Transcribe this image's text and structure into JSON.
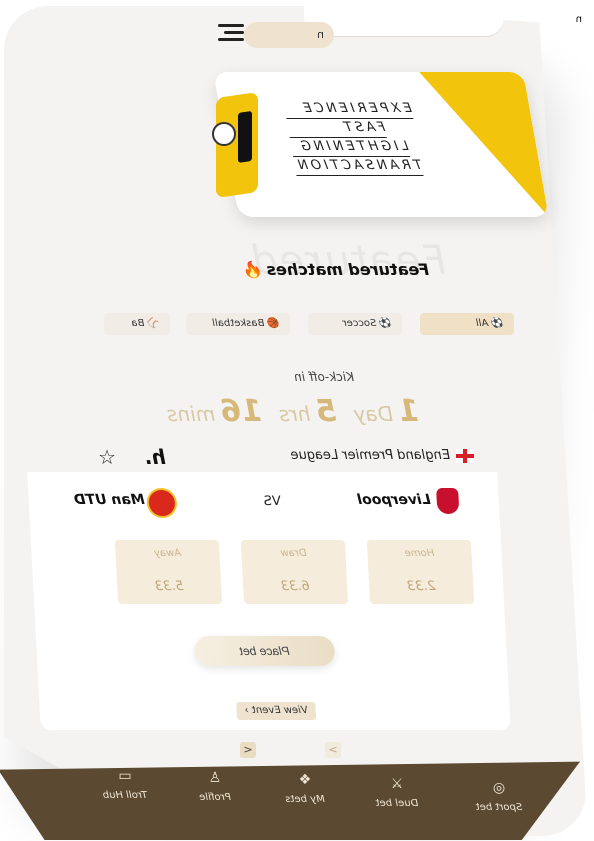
{
  "header": {
    "pill_text": "n",
    "corner_tag": "n"
  },
  "banner": {
    "lines": [
      "EXPERIENCE",
      "FAST",
      "LIGHTENING",
      "TRANSACTION"
    ]
  },
  "featured": {
    "ghost_text": "Featured",
    "title": "Featured matches",
    "emoji": "🔥"
  },
  "sports_tabs": [
    {
      "label": "All",
      "icon": "⚽",
      "active": true
    },
    {
      "label": "Soccer",
      "icon": "⚽",
      "active": false
    },
    {
      "label": "Basketball",
      "icon": "🏀",
      "active": false
    },
    {
      "label": "Ba",
      "icon": "⚾",
      "active": false
    }
  ],
  "kickoff": {
    "label": "Kick-off in",
    "days": "1",
    "days_unit": "Day",
    "hours": "5",
    "hours_unit": "hrs",
    "mins": "16",
    "mins_unit": "mins"
  },
  "league": {
    "name": "England Premier League",
    "brand": "h."
  },
  "match": {
    "home_team": "Liverpool",
    "away_team": "Man UTD",
    "vs": "VS",
    "odds": [
      {
        "label": "Home",
        "value": "2.33"
      },
      {
        "label": "Draw",
        "value": "6.33"
      },
      {
        "label": "Away",
        "value": "5.33"
      }
    ],
    "place_bet": "Place bet",
    "view_event": "View Event"
  },
  "pager": {
    "prev": "<",
    "next": ">"
  },
  "bottom_nav": [
    {
      "label": "Sport bet",
      "icon": "basketball-icon"
    },
    {
      "label": "Duel bet",
      "icon": "swords-icon"
    },
    {
      "label": "My bets",
      "icon": "layers-icon"
    },
    {
      "label": "Profile",
      "icon": "user-icon"
    },
    {
      "label": "Troll Hub",
      "icon": "chat-icon"
    }
  ],
  "colors": {
    "accent_gold": "#d6b97a",
    "nav_brown": "#5b4a31",
    "banner_yellow": "#f2c40c"
  }
}
